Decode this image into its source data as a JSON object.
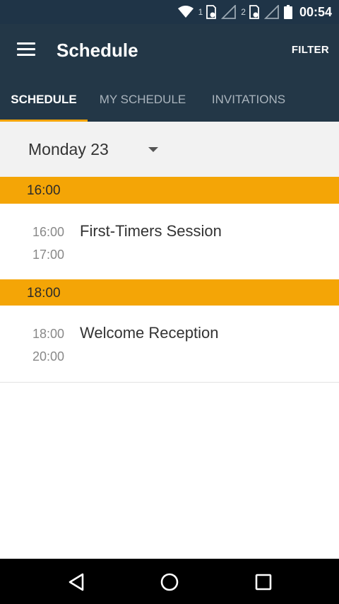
{
  "status_bar": {
    "sim1": "1",
    "sim2": "2",
    "time": "00:54",
    "icons": [
      "wifi-icon",
      "sim1-icon",
      "signal1-icon",
      "sim2-icon",
      "signal2-icon",
      "battery-icon"
    ]
  },
  "app_bar": {
    "title": "Schedule",
    "filter_label": "FILTER",
    "menu_icon": "hamburger-menu-icon"
  },
  "tabs": [
    {
      "label": "SCHEDULE",
      "active": true
    },
    {
      "label": "MY SCHEDULE",
      "active": false
    },
    {
      "label": "INVITATIONS",
      "active": false
    }
  ],
  "day_selector": {
    "value": "Monday 23",
    "icon": "dropdown-arrow-icon"
  },
  "groups": [
    {
      "time": "16:00",
      "sessions": [
        {
          "start": "16:00",
          "end": "17:00",
          "title": "First-Timers Session"
        }
      ]
    },
    {
      "time": "18:00",
      "sessions": [
        {
          "start": "18:00",
          "end": "20:00",
          "title": "Welcome Reception"
        }
      ]
    }
  ],
  "nav_bar": {
    "icons": [
      "back-icon",
      "home-icon",
      "recents-icon"
    ]
  },
  "colors": {
    "app_bar": "#233747",
    "status_bar": "#1f3447",
    "accent": "#f4a506",
    "day_bar": "#f2f2f2"
  }
}
